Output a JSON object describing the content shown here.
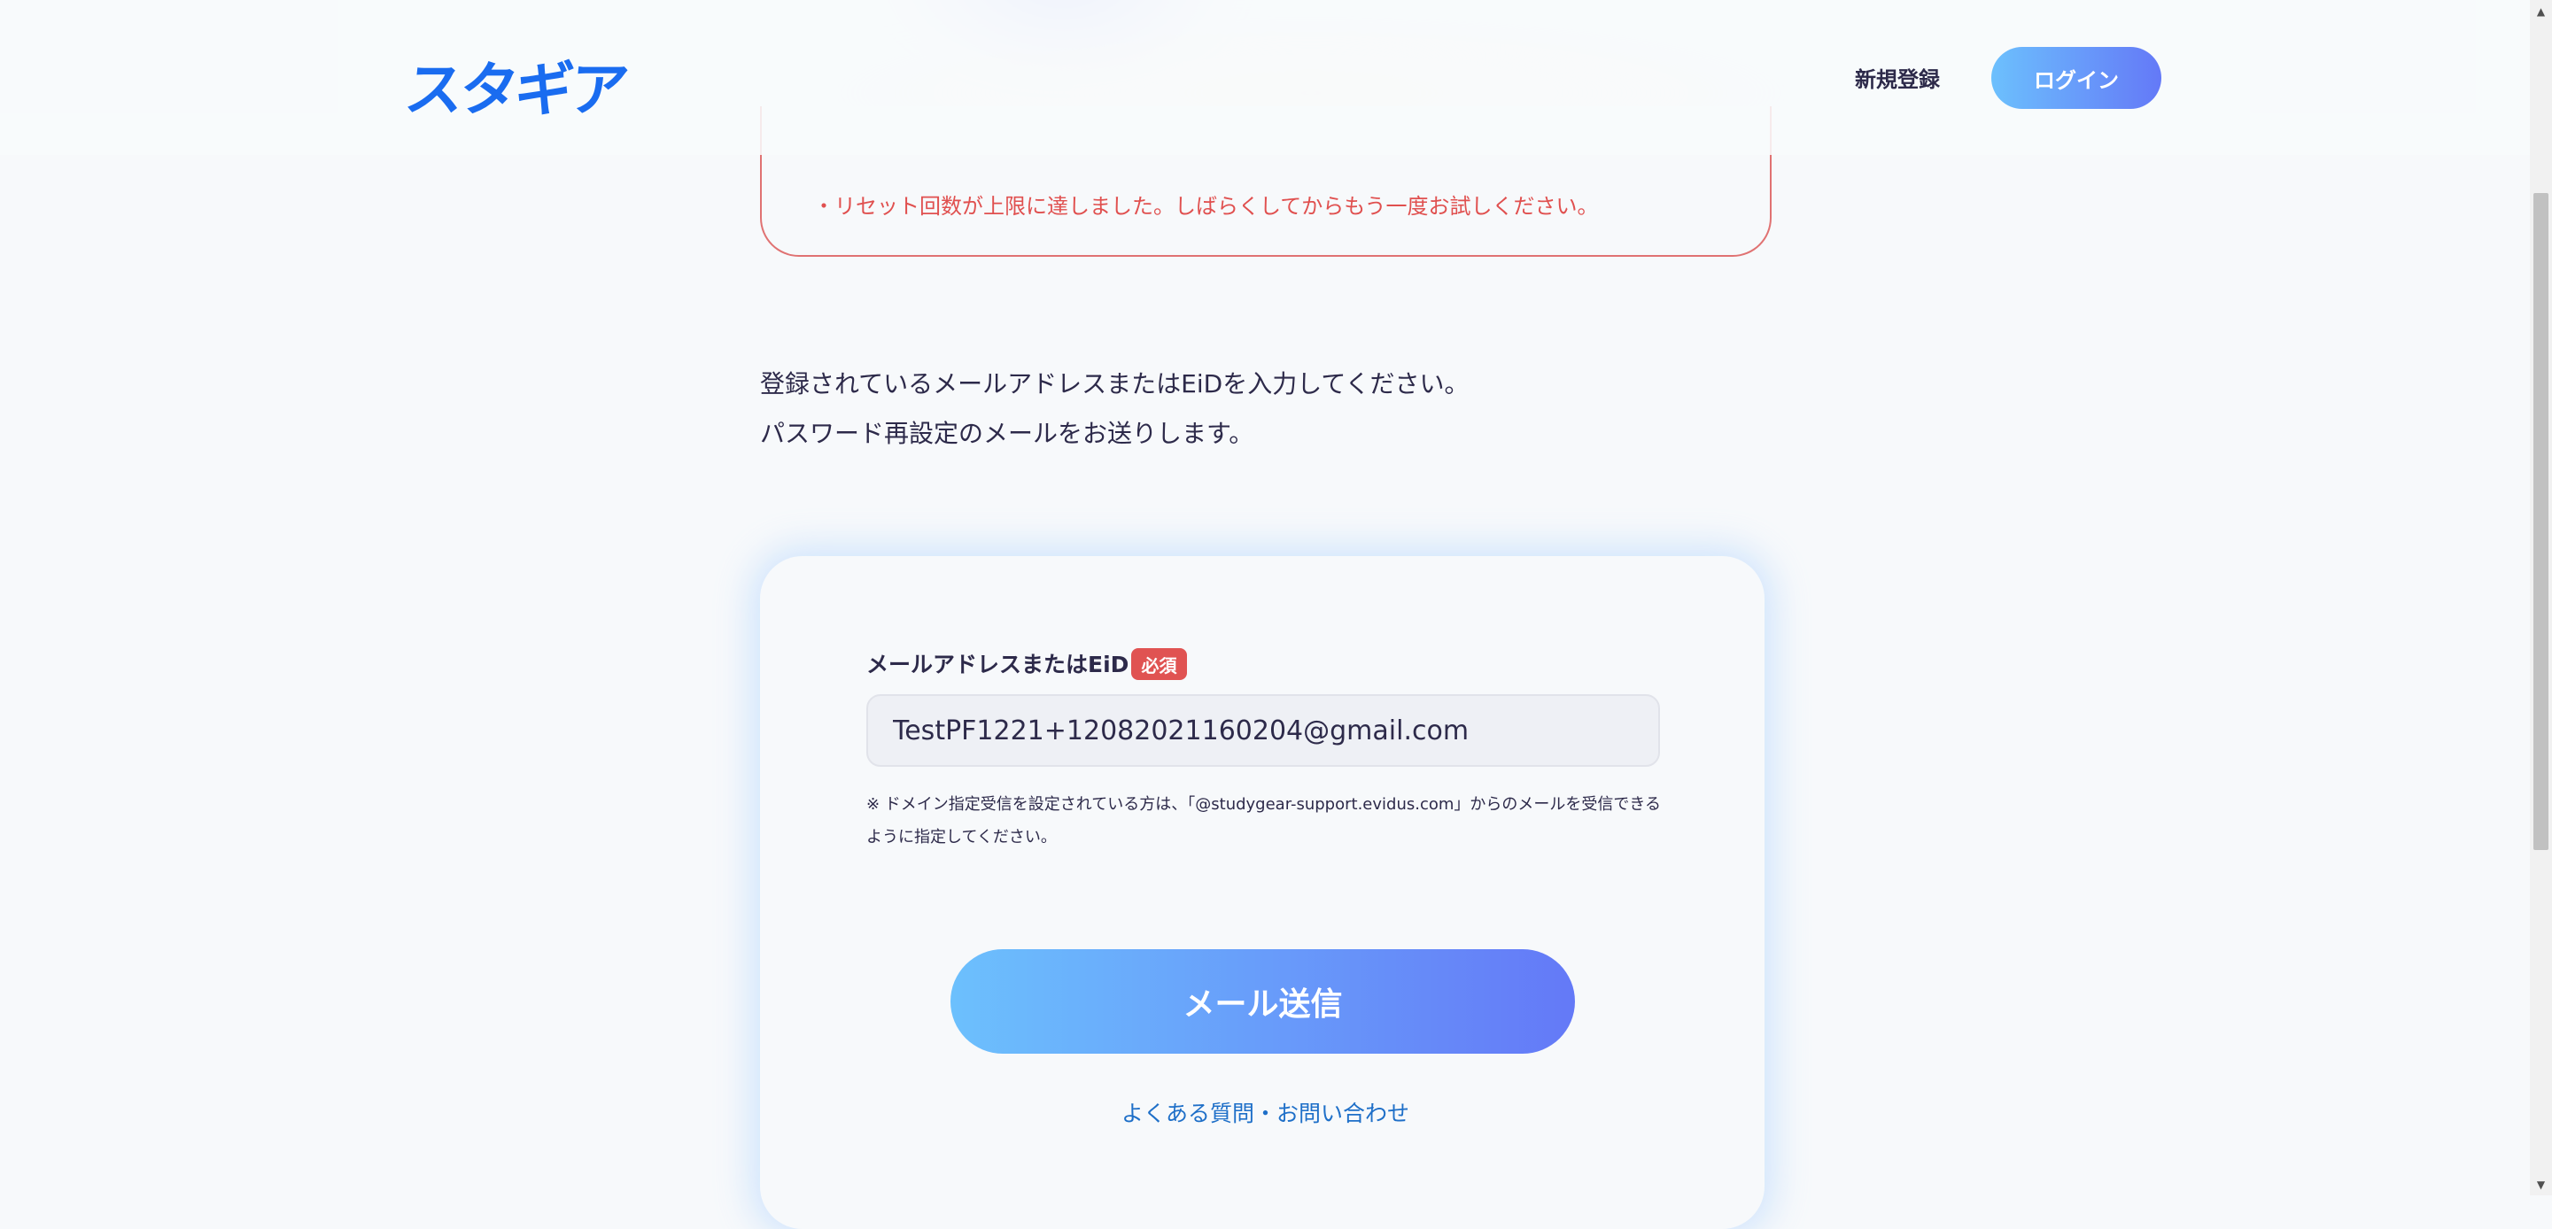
{
  "header": {
    "logo_text": "スタギア",
    "signup_label": "新規登録",
    "login_label": "ログイン"
  },
  "error": {
    "message": "・リセット回数が上限に達しました。しばらくしてからもう一度お試しください。"
  },
  "intro": {
    "line1": "登録されているメールアドレスまたはEiDを入力してください。",
    "line2": "パスワード再設定のメールをお送りします。"
  },
  "form": {
    "email_label": "メールアドレスまたはEiD",
    "required_badge": "必須",
    "email_value": "TestPF1221+12082021160204@gmail.com",
    "note": "※ ドメイン指定受信を設定されている方は、「@studygear-support.evidus.com」からのメールを受信できるように指定してください。",
    "submit_label": "メール送信",
    "faq_link": "よくある質問・お問い合わせ"
  },
  "colors": {
    "brand": "#1a6cf0",
    "gradient_start": "#6cc0fd",
    "gradient_end": "#6479f7",
    "error": "#e0504f",
    "link": "#1e6fc8"
  }
}
